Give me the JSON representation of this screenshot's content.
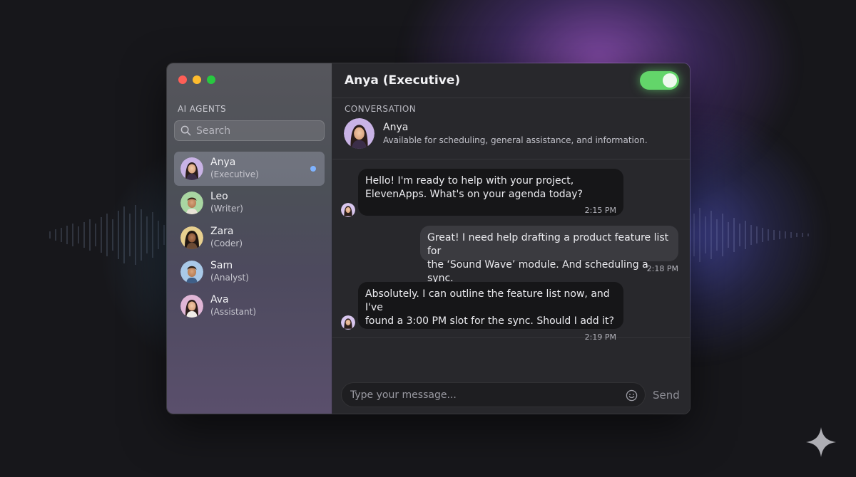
{
  "sidebar": {
    "section_label": "AI AGENTS",
    "search_placeholder": "Search",
    "agents": [
      {
        "name": "Anya",
        "role": "(Executive)",
        "active": true,
        "unread": true
      },
      {
        "name": "Leo",
        "role": "(Writer)",
        "active": false,
        "unread": false
      },
      {
        "name": "Zara",
        "role": "(Coder)",
        "active": false,
        "unread": false
      },
      {
        "name": "Sam",
        "role": "(Analyst)",
        "active": false,
        "unread": false
      },
      {
        "name": "Ava",
        "role": "(Assistant)",
        "active": false,
        "unread": false
      }
    ]
  },
  "header": {
    "title": "Anya (Executive)",
    "toggle_on": true
  },
  "conversation": {
    "label": "CONVERSATION",
    "agent_name": "Anya",
    "agent_description": "Available for scheduling, general assistance, and information."
  },
  "messages": [
    {
      "from": "agent",
      "lines": [
        "Hello! I'm ready to help with your project,",
        "ElevenApps. What's on your agenda today?"
      ],
      "time": "2:15 PM"
    },
    {
      "from": "user",
      "lines": [
        "Great! I need help drafting a product feature list for",
        "the ‘Sound Wave’ module. And scheduling a sync."
      ],
      "time": "2:18 PM"
    },
    {
      "from": "agent",
      "lines": [
        "Absolutely. I can outline the feature list now, and I've",
        "found a 3:00 PM slot for the sync. Should I add it?"
      ],
      "time": "2:19 PM"
    }
  ],
  "composer": {
    "placeholder": "Type your message...",
    "send_label": "Send"
  },
  "icons": {
    "search": "search-icon",
    "emoji": "emoji-icon",
    "sparkle": "sparkle-icon"
  },
  "colors": {
    "toggle_on": "#63d56a",
    "unread_dot": "#7fb3ff",
    "wave_accent": "#8fb6ff"
  }
}
